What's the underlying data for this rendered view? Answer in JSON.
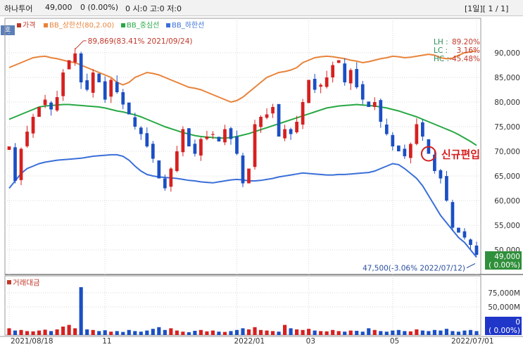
{
  "header": {
    "stock_name": "하나투어",
    "price": "49,000",
    "change": "0 (0.00%)",
    "ohlc": "0  시:0  고:0  저:0",
    "period": "[1일][ 1 / 1]"
  },
  "side_tag": "호",
  "legend": [
    {
      "label": "가격",
      "color": "#c0392b"
    },
    {
      "label": "BB_상한선(80,2.00)",
      "color": "#e8833a"
    },
    {
      "label": "BB_중심선",
      "color": "#27a844"
    },
    {
      "label": "BB_하한선",
      "color": "#3a6fd8"
    }
  ],
  "stats": {
    "lh_label": "LH :",
    "lh_value": "89.20%",
    "lc_label": "LC :",
    "lc_value": "3.16%",
    "hc_label": "HC :",
    "hc_value": "-45.48%"
  },
  "annotations": {
    "high": "89,869(83.41% 2021/09/24)",
    "low": "47,500(-3.06% 2022/07/12)",
    "new_entry": "신규편입"
  },
  "price_box": {
    "value": "49,000",
    "pct": "( 0.00%)"
  },
  "volume_box": {
    "value": "0",
    "pct": "( 0.00%)"
  },
  "volume_title": "거래대금",
  "chart_data": [
    {
      "type": "candlestick",
      "title": "",
      "ylim": [
        45000,
        95000
      ],
      "y_ticks": [
        "90,000",
        "85,000",
        "80,000",
        "75,000",
        "70,000",
        "65,000",
        "60,000",
        "55,000",
        "50,000"
      ],
      "x_ticks": [
        "2021/08/18",
        "11",
        "2022/01",
        "03",
        "05",
        "2022/07/01"
      ],
      "series": [
        {
          "name": "가격",
          "close": [
            71000,
            64000,
            70500,
            74000,
            77000,
            79000,
            80500,
            78500,
            81000,
            86000,
            88500,
            89869,
            84000,
            82500,
            86000,
            84000,
            80500,
            84500,
            82000,
            79500,
            77500,
            75000,
            73500,
            71000,
            68500,
            64500,
            62500,
            66500,
            70000,
            74500,
            71000,
            69500,
            72500,
            73000,
            73500,
            72000,
            74500,
            72500,
            69500,
            63500,
            66500,
            75500,
            77000,
            77500,
            79000,
            73000,
            74500,
            73500,
            76000,
            80000,
            84500,
            82500,
            83500,
            85000,
            87500,
            88500,
            84000,
            86500,
            83000,
            80500,
            79000,
            80000,
            76000,
            73500,
            71000,
            70000,
            69000,
            71500,
            75500,
            73000,
            69500,
            66000,
            64500,
            60000,
            54500,
            53500,
            52500,
            51000,
            49000
          ]
        },
        {
          "name": "BB_상한선(80,2.00)",
          "values": [
            87000,
            87500,
            88000,
            88500,
            89000,
            89200,
            89300,
            89000,
            88800,
            88500,
            88200,
            88000,
            87500,
            87000,
            86500,
            86000,
            85500,
            85000,
            84000,
            83500,
            84000,
            85000,
            85500,
            86000,
            85800,
            85500,
            85000,
            84500,
            84000,
            83500,
            83000,
            82800,
            82500,
            82000,
            81500,
            81000,
            80500,
            80000,
            80300,
            81000,
            82000,
            83000,
            84000,
            85000,
            85500,
            86000,
            86200,
            86500,
            87000,
            88000,
            88500,
            89000,
            89200,
            89300,
            89200,
            89000,
            88800,
            88500,
            88300,
            88000,
            88200,
            88500,
            88800,
            89000,
            89300,
            89200,
            89000,
            89100,
            89300,
            89500,
            89700,
            89500,
            89000,
            88800,
            88900,
            89500,
            90000,
            90200,
            90400
          ]
        },
        {
          "name": "BB_중심선",
          "values": [
            76500,
            77000,
            77500,
            78000,
            78500,
            79000,
            79200,
            79300,
            79400,
            79500,
            79500,
            79400,
            79300,
            79200,
            79100,
            79000,
            78800,
            78500,
            78200,
            78000,
            77700,
            77400,
            77000,
            76500,
            76000,
            75500,
            75000,
            74600,
            74200,
            73800,
            73500,
            73200,
            73000,
            72900,
            72800,
            72700,
            72700,
            72800,
            73000,
            73300,
            73600,
            74000,
            74400,
            74800,
            75200,
            75600,
            76000,
            76400,
            76800,
            77200,
            77600,
            78000,
            78400,
            78800,
            79000,
            79200,
            79300,
            79400,
            79500,
            79400,
            79300,
            79200,
            79000,
            78800,
            78500,
            78200,
            77800,
            77400,
            77000,
            76500,
            76000,
            75500,
            75000,
            74500,
            74000,
            73400,
            72700,
            72000,
            71200
          ]
        },
        {
          "name": "BB_하한선",
          "values": [
            62500,
            64000,
            65500,
            66500,
            67000,
            67500,
            67800,
            68000,
            68200,
            68300,
            68400,
            68500,
            68600,
            68800,
            69000,
            69100,
            69200,
            69300,
            69300,
            69000,
            68200,
            67000,
            66000,
            65300,
            65000,
            64800,
            64700,
            64600,
            64500,
            64300,
            64100,
            64000,
            63800,
            63700,
            63600,
            63800,
            64000,
            64200,
            64300,
            64200,
            64000,
            64000,
            64100,
            64300,
            64500,
            64800,
            65000,
            65200,
            65400,
            65600,
            65500,
            65400,
            65300,
            65200,
            65200,
            65300,
            65300,
            65400,
            65500,
            65600,
            65700,
            66000,
            66500,
            67000,
            67500,
            67300,
            66500,
            65500,
            64500,
            63000,
            61000,
            59000,
            57000,
            55500,
            54000,
            52500,
            51500,
            50000,
            48500
          ]
        }
      ]
    },
    {
      "type": "bar",
      "title": "",
      "ylim": [
        0,
        100000
      ],
      "y_ticks": [
        "75,000M",
        "50,000M"
      ],
      "series": [
        {
          "name": "거래대금",
          "values": [
            12000,
            8000,
            9000,
            7000,
            6500,
            8000,
            9500,
            7000,
            10000,
            15000,
            18000,
            12000,
            85000,
            10000,
            9000,
            7000,
            8500,
            6000,
            7000,
            5500,
            9000,
            7000,
            6000,
            8000,
            11000,
            14000,
            9000,
            12000,
            8000,
            6000,
            5000,
            7500,
            9000,
            6500,
            8000,
            6000,
            5500,
            7000,
            9000,
            12000,
            10000,
            14000,
            9000,
            8000,
            7000,
            6000,
            18000,
            12000,
            10000,
            9000,
            11000,
            8000,
            7000,
            6500,
            9000,
            7000,
            6000,
            8000,
            7500,
            6000,
            12000,
            9000,
            7000,
            6000,
            8000,
            9000,
            7000,
            6500,
            10000,
            8000,
            7000,
            9000,
            8000,
            11000,
            7000,
            6000,
            8000,
            9000,
            7000
          ]
        }
      ]
    }
  ]
}
